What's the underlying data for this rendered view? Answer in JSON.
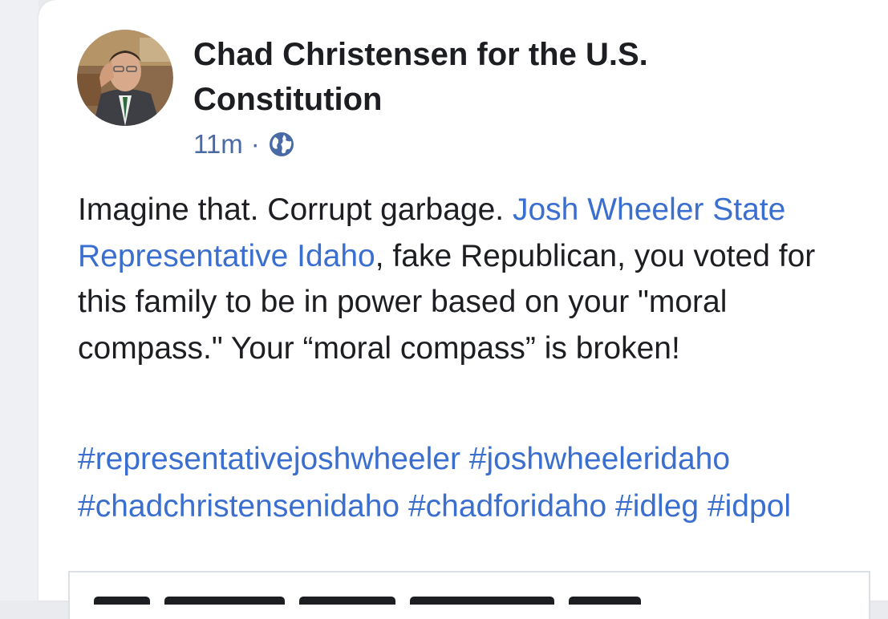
{
  "post": {
    "author": "Chad Christensen for the U.S. Constitution",
    "timestamp": "11m",
    "separator": "·",
    "audience_icon": "globe-icon",
    "body": {
      "part1": "Imagine that. Corrupt garbage. ",
      "mention": "Josh Wheeler State Representative Idaho",
      "part2": ", fake Republican, you voted for this family to be in power based on your \"moral compass.\" Your “moral compass” is broken!"
    },
    "hashtags": [
      "#representativejoshwheeler",
      "#joshwheeleridaho",
      "#chadchristensenidaho",
      "#chadforidaho",
      "#idleg",
      "#idpol"
    ]
  },
  "colors": {
    "link": "#3a6fd0",
    "meta": "#4a6aa5",
    "text": "#1c1e21"
  }
}
